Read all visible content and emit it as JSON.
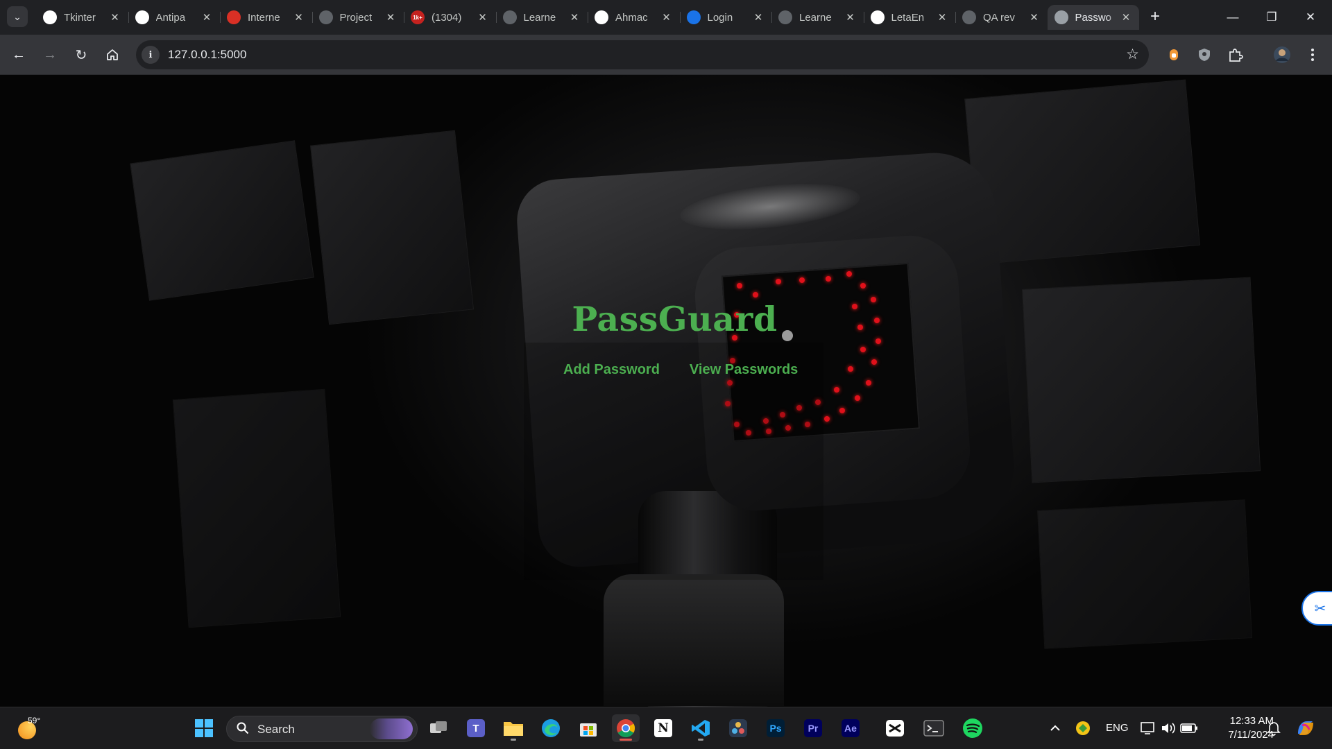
{
  "browser": {
    "tabs": [
      {
        "title": "Tkinter",
        "icon": "openai-icon",
        "fav_color": "#ffffff"
      },
      {
        "title": "Antipa",
        "icon": "github-icon",
        "fav_color": "#ffffff"
      },
      {
        "title": "Interne",
        "icon": "speedometer-icon",
        "fav_color": "#d93025"
      },
      {
        "title": "Project",
        "icon": "notion-style-icon",
        "fav_color": "#5f6368"
      },
      {
        "title": "(1304)",
        "icon": "badge-icon",
        "fav_color": "#c5221f",
        "badge": "1k+"
      },
      {
        "title": "Learne",
        "icon": "notion-style-icon",
        "fav_color": "#5f6368"
      },
      {
        "title": "Ahmac",
        "icon": "github-icon",
        "fav_color": "#ffffff"
      },
      {
        "title": "Login",
        "icon": "canva-icon",
        "fav_color": "#1a73e8"
      },
      {
        "title": "Learne",
        "icon": "notion-style-icon",
        "fav_color": "#5f6368"
      },
      {
        "title": "LetaEn",
        "icon": "github-icon",
        "fav_color": "#ffffff"
      },
      {
        "title": "QA rev",
        "icon": "notion-style-icon",
        "fav_color": "#5f6368"
      },
      {
        "title": "Passwo",
        "icon": "globe-icon",
        "fav_color": "#9aa0a6",
        "active": true
      }
    ],
    "url": "127.0.0.1:5000"
  },
  "app": {
    "title": "PassGuard",
    "nav": [
      "Add Password",
      "View Passwords"
    ],
    "accent": "#4caf50"
  },
  "taskbar": {
    "weather_temp": "59°",
    "search_label": "Search",
    "apps": [
      "task-view-icon",
      "teams-icon",
      "file-explorer-icon",
      "edge-icon",
      "store-icon",
      "chrome-icon",
      "notion-icon",
      "vscode-icon",
      "davinci-icon",
      "photoshop-icon",
      "premiere-icon",
      "after-effects-icon",
      "capcut-icon",
      "terminal-icon",
      "spotify-icon"
    ],
    "app_labels": {
      "photoshop": "Ps",
      "premiere": "Pr",
      "after_effects": "Ae",
      "teams": "T",
      "notion": "N"
    },
    "language": "ENG",
    "time": "12:33 AM",
    "date": "7/11/2024"
  }
}
